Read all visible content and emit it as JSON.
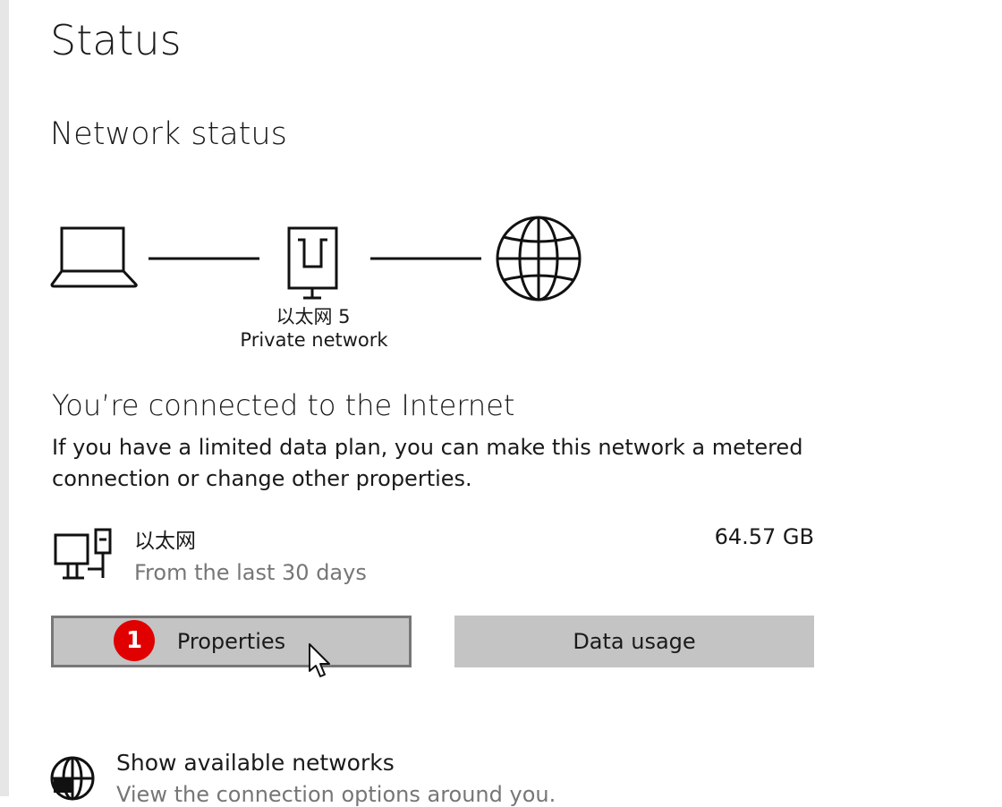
{
  "page": {
    "title": "Status",
    "section_title": "Network status"
  },
  "diagram": {
    "adapter_name": "以太网 5",
    "network_type": "Private network",
    "icons": [
      "laptop-icon",
      "ethernet-adapter-icon",
      "globe-icon"
    ]
  },
  "connection": {
    "heading": "You’re connected to the Internet",
    "description": "If you have a limited data plan, you can make this network a metered connection or change other properties."
  },
  "adapter_usage": {
    "icon": "wired-pc-icon",
    "name": "以太网",
    "period": "From the last 30 days",
    "amount": "64.57 GB"
  },
  "buttons": {
    "properties": "Properties",
    "data_usage": "Data usage"
  },
  "annotation": {
    "step_number": "1",
    "color": "#e00000"
  },
  "show_networks": {
    "icon": "globe-icon",
    "label": "Show available networks",
    "subtitle": "View the connection options around you."
  }
}
